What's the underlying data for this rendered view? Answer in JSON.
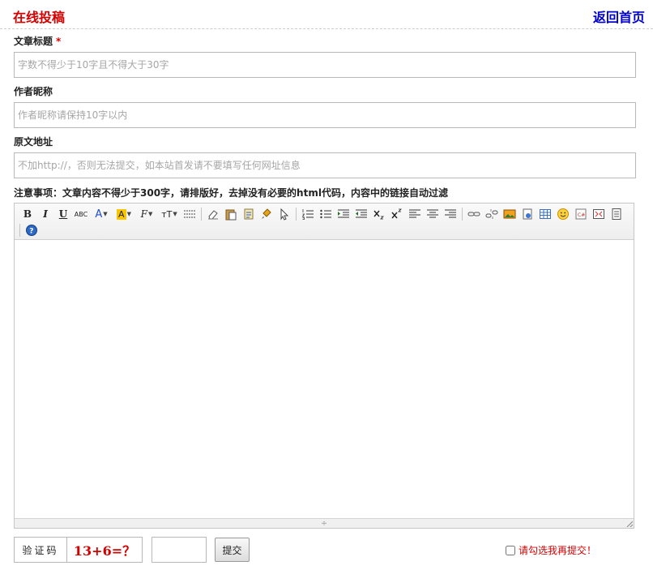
{
  "header": {
    "title": "在线投稿",
    "home_link": "返回首页"
  },
  "form": {
    "title_label": "文章标题",
    "title_required_mark": "*",
    "title_placeholder": "字数不得少于10字且不得大于30字",
    "author_label": "作者昵称",
    "author_placeholder": "作者昵称请保持10字以内",
    "source_label": "原文地址",
    "source_placeholder": "不加http://，否则无法提交，如本站首发请不要填写任何网址信息",
    "notice": "注意事项：文章内容不得少于300字，请排版好，去掉没有必要的html代码，内容中的链接自动过滤"
  },
  "editor": {
    "toolbar": {
      "bold": "B",
      "italic": "I",
      "underline": "U",
      "strikethrough": "ABC",
      "font_color": "A",
      "highlight": "A",
      "font_family": "F",
      "font_size": "тT",
      "icons": [
        "bold-icon",
        "italic-icon",
        "underline-icon",
        "strikethrough-icon",
        "font-color-icon",
        "highlight-icon",
        "font-family-icon",
        "font-size-icon",
        "horizontal-rule-icon",
        "eraser-icon",
        "paste-icon",
        "paste-word-icon",
        "format-brush-icon",
        "select-all-icon",
        "ordered-list-icon",
        "unordered-list-icon",
        "indent-icon",
        "outdent-icon",
        "subscript-icon",
        "superscript-icon",
        "align-left-icon",
        "align-center-icon",
        "align-right-icon",
        "link-icon",
        "unlink-icon",
        "image-icon",
        "flash-icon",
        "table-icon",
        "emoticon-icon",
        "code-icon",
        "fullscreen-icon",
        "source-icon",
        "help-icon"
      ]
    }
  },
  "captcha": {
    "label": "验证码",
    "question": "13+6=？",
    "submit": "提交"
  },
  "confirm": {
    "text": "请勾选我再提交！"
  },
  "colors": {
    "accent_red": "#d40000",
    "link_blue": "#0000cc",
    "highlight_yellow": "#f7c600"
  }
}
